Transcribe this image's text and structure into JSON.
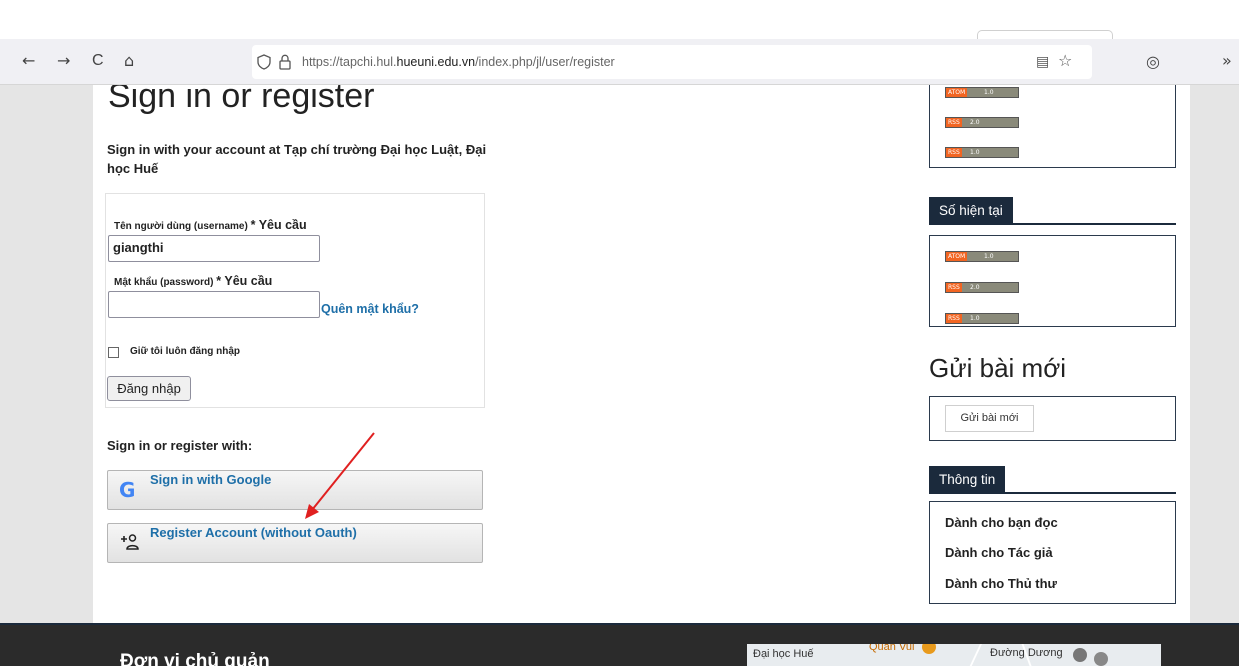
{
  "browser": {
    "nav_back": "←",
    "nav_forward": "→",
    "nav_reload": "C",
    "nav_home": "⌂",
    "url_prefix": "https://tapchi.hul.",
    "url_domain": "hueuni.edu.vn",
    "url_suffix": "/index.php/jl/user/register",
    "reader_icon": "▤",
    "star_icon": "☆",
    "pocket_icon": "◎",
    "overflow_icon": "»"
  },
  "main": {
    "title": "Sign in or register",
    "intro": "Sign in with your account at Tạp chí trường Đại học Luật, Đại học Huế",
    "form": {
      "username_label": "Tên người dùng (username)",
      "required_mark": "* Yêu cầu",
      "username_value": "giangthi",
      "password_label": "Mật khẩu (password)",
      "password_value": "",
      "forgot_link": "Quên mật khẩu?",
      "remember_label": "Giữ tôi luôn đăng nhập",
      "login_button": "Đăng nhập"
    },
    "register_with": "Sign in or register with:",
    "google_button": "Sign in with Google",
    "google_icon": "G",
    "register_button": "Register Account (without Oauth)",
    "register_icon": "+👤"
  },
  "sidebar": {
    "feeds_top": [
      {
        "left": "ATOM",
        "right": "1.0"
      },
      {
        "left": "RSS",
        "right": "2.0"
      },
      {
        "left": "RSS",
        "right": "1.0"
      }
    ],
    "current_issue_title": "Số hiện tại",
    "feeds_current": [
      {
        "left": "ATOM",
        "right": "1.0"
      },
      {
        "left": "RSS",
        "right": "2.0"
      },
      {
        "left": "RSS",
        "right": "1.0"
      }
    ],
    "submit_heading": "Gửi bài mới",
    "submit_button": "Gửi bài mới",
    "info_title": "Thông tin",
    "info_links": [
      "Dành cho bạn đọc",
      "Dành cho Tác giả",
      "Dành cho Thủ thư"
    ]
  },
  "footer": {
    "title": "Đơn vị chủ quản",
    "map_labels": [
      "Đại học Huế",
      "Quán Vui",
      "Đường Dương"
    ]
  },
  "colors": {
    "link": "#1e6fa8",
    "sidebar_title_bg": "#1b2a3c",
    "feed_orange": "#f26522",
    "annotation_arrow": "#e02020"
  }
}
